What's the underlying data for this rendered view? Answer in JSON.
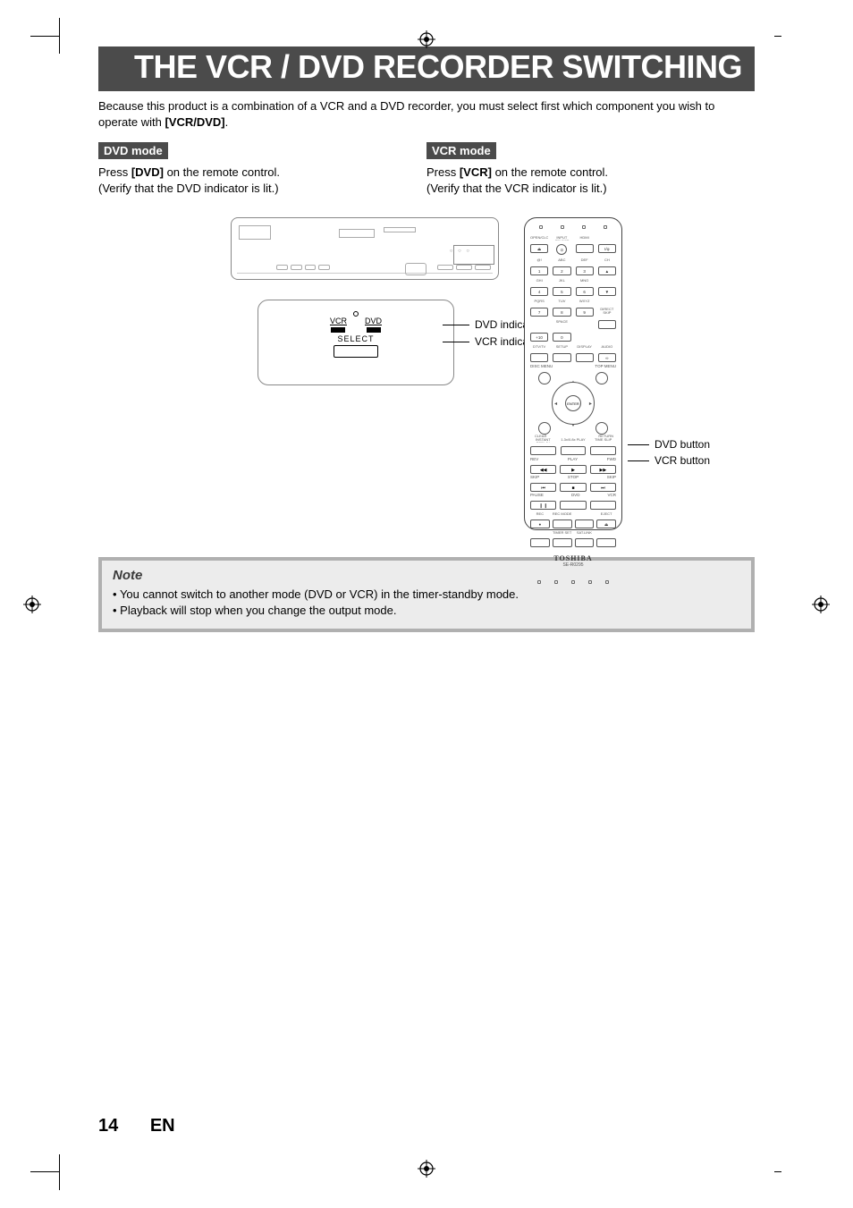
{
  "title": "THE VCR / DVD RECORDER SWITCHING",
  "intro_a": "Because this product is a combination of a VCR and a DVD recorder, you must select first which component you wish to operate with ",
  "intro_bold": "[VCR/DVD]",
  "intro_b": ".",
  "dvd": {
    "label": "DVD mode",
    "line1_a": "Press ",
    "line1_bold": "[DVD]",
    "line1_b": " on the remote control.",
    "line2": "(Verify that the DVD indicator is lit.)"
  },
  "vcr": {
    "label": "VCR mode",
    "line1_a": "Press ",
    "line1_bold": "[VCR]",
    "line1_b": " on the remote control.",
    "line2": "(Verify that the VCR indicator is lit.)"
  },
  "select_panel": {
    "vcr": "VCR",
    "dvd": "DVD",
    "select": "SELECT",
    "lead_dvd": "DVD indicator",
    "lead_vcr": "VCR indicator"
  },
  "remote": {
    "labels": {
      "open_close": "OPEN/CLOSE",
      "input_select": "INPUT SELECT",
      "hdmi": "HDMI",
      "io": "I/φ",
      "at": "@!",
      "abc": "ABC",
      "def": "DEF",
      "ch": "CH",
      "ghi": "GHI",
      "jkl": "JKL",
      "mno": "MNO",
      "pqrs": "PQRS",
      "tuv": "TUV",
      "wxyz": "WXYZ",
      "space": "SPACE",
      "direct_skip": "DIRECT SKIP",
      "dtv_tv": "DTV/TV",
      "setup": "SETUP",
      "display": "DISPLAY",
      "audio": "AUDIO",
      "disc_menu": "DISC MENU",
      "top_menu": "TOP MENU",
      "enter": "ENTER",
      "clear": "CLEAR",
      "return": "RETURN",
      "instant_replay": "INSTANT REPLAY",
      "12bit": "1.3x/0.8x PLAY",
      "time_slip": "TIME SLIP",
      "rev": "REV",
      "play": "PLAY",
      "fwd": "FWD",
      "skip": "SKIP",
      "stop": "STOP",
      "pause": "PAUSE",
      "dvd": "DVD",
      "vcr": "VCR",
      "rec": "REC",
      "rec_mode": "REC MODE",
      "timer_set": "TIMER SET",
      "satlink": "SAT.LINK",
      "eject": "EJECT"
    },
    "keys": {
      "one": "1",
      "two": "2",
      "three": "3",
      "four": "4",
      "five": "5",
      "six": "6",
      "seven": "7",
      "eight": "8",
      "nine": "9",
      "zero": "0",
      "dotbox": "+10",
      "up": "▲",
      "down": "▼",
      "eject": "⏏",
      "rev": "◀◀",
      "play": "▶",
      "fwd": "▶▶",
      "skipb": "⏮",
      "stop": "■",
      "skipf": "⏭",
      "pause": "❙ ❙",
      "rec": "●"
    },
    "brand": "TOSHIBA",
    "model": "SE-R0295",
    "lead_dvd": "DVD button",
    "lead_vcr": "VCR button"
  },
  "note": {
    "title": "Note",
    "items": [
      "You cannot switch to another mode (DVD or VCR) in the timer-standby mode.",
      "Playback will stop when you change the output mode."
    ]
  },
  "page_number": "14",
  "page_lang": "EN"
}
